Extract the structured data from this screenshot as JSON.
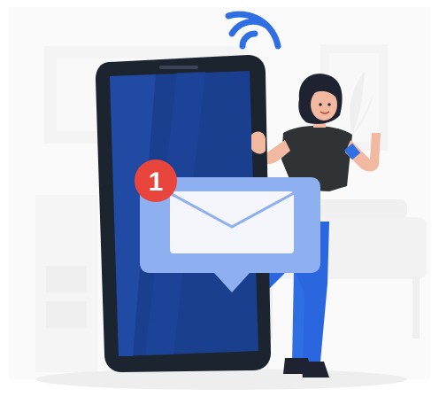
{
  "illustration": {
    "notification_badge": {
      "count": "1"
    }
  },
  "colors": {
    "phone_body": "#1b3f8f",
    "phone_frame": "#1c2430",
    "accent_blue": "#2f6fe3",
    "light_blue_panel": "#8fb0f0",
    "badge_red": "#e8453c",
    "envelope_white": "#f4f6fb",
    "background_gray": "#ececec",
    "shirt": "#2f3336",
    "skin": "#f2b8a0",
    "hair": "#1f2230"
  }
}
